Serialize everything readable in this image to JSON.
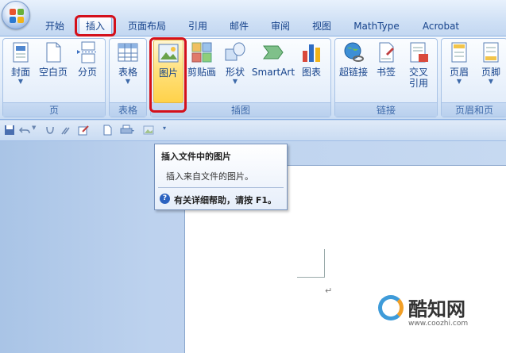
{
  "tabs": [
    {
      "label": "开始"
    },
    {
      "label": "插入"
    },
    {
      "label": "页面布局"
    },
    {
      "label": "引用"
    },
    {
      "label": "邮件"
    },
    {
      "label": "审阅"
    },
    {
      "label": "视图"
    },
    {
      "label": "MathType"
    },
    {
      "label": "Acrobat"
    }
  ],
  "ribbon": {
    "groups": [
      {
        "label": "页"
      },
      {
        "label": "表格"
      },
      {
        "label": "插图"
      },
      {
        "label": "链接"
      },
      {
        "label": "页眉和页"
      }
    ],
    "buttons": [
      {
        "label": "封面",
        "has_arrow": true
      },
      {
        "label": "空白页"
      },
      {
        "label": "分页"
      },
      {
        "label": "表格",
        "has_arrow": true
      },
      {
        "label": "图片"
      },
      {
        "label": "剪贴画"
      },
      {
        "label": "形状",
        "has_arrow": true
      },
      {
        "label": "SmartArt"
      },
      {
        "label": "图表"
      },
      {
        "label": "超链接"
      },
      {
        "label": "书签"
      },
      {
        "label": "交叉\n引用"
      },
      {
        "label": "页眉",
        "has_arrow": true
      },
      {
        "label": "页脚",
        "has_arrow": true
      }
    ]
  },
  "tooltip": {
    "title": "插入文件中的图片",
    "description": "插入来自文件的图片。",
    "help": "有关详细帮助，请按 F1。"
  },
  "document": {
    "paragraph_mark": "↵"
  },
  "watermark": {
    "name": "酷知网",
    "url": "www.coozhi.com"
  },
  "colors": {
    "highlight_red": "#d4101b",
    "active_button": "#ffd24a",
    "ribbon_text": "#15428b"
  }
}
